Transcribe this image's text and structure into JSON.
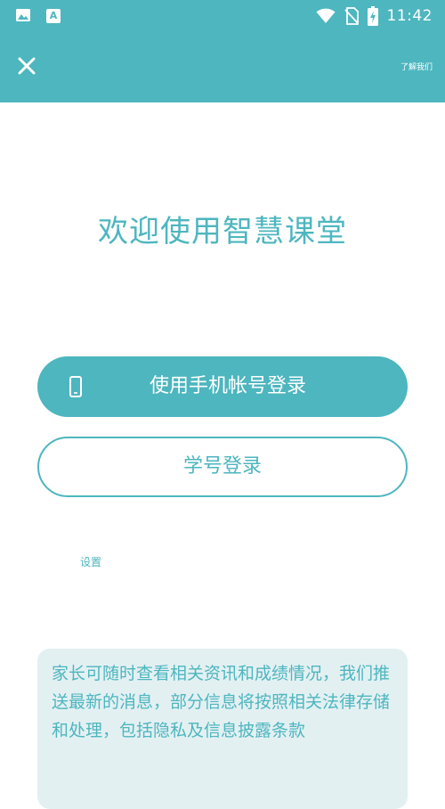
{
  "status_bar": {
    "time": "11:42",
    "left_icons": [
      "image-icon",
      "a-icon"
    ],
    "a_icon_letter": "A",
    "right_icons": [
      "wifi-icon",
      "no-sim-icon",
      "battery-charging-icon"
    ]
  },
  "header": {
    "close_icon": "close-icon",
    "about_label": "了解我们"
  },
  "main": {
    "welcome_title": "欢迎使用智慧课堂",
    "phone_login_label": "使用手机帐号登录",
    "phone_login_icon": "smartphone-icon",
    "student_login_label": "学号登录",
    "settings_label": "设置"
  },
  "notice": {
    "text": "家长可随时查看相关资讯和成绩情况，我们推送最新的消息，部分信息将按照相关法律存储和处理，包括隐私及信息披露条款"
  },
  "colors": {
    "primary": "#4db6bf",
    "notice_background": "#e3f0f2",
    "background": "#ffffff"
  }
}
